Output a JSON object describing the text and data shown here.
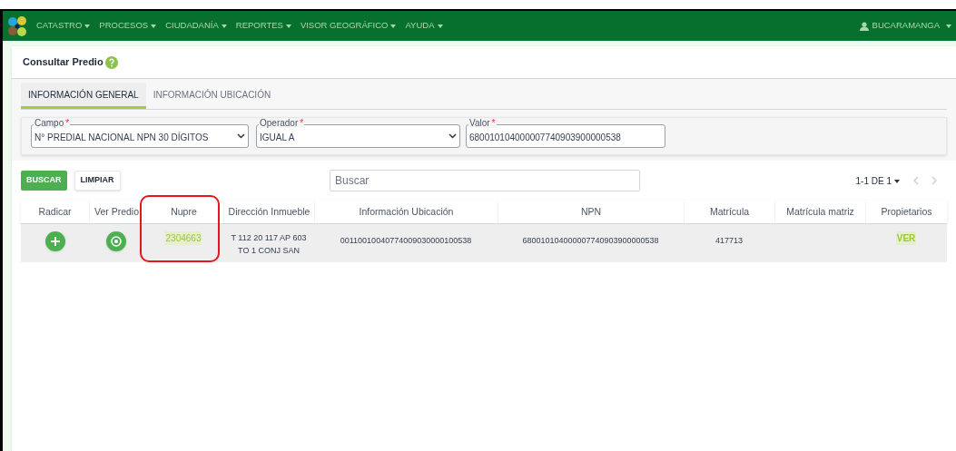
{
  "nav": {
    "menu": [
      {
        "label": "CATASTRO"
      },
      {
        "label": "PROCESOS"
      },
      {
        "label": "CIUDADANÍA"
      },
      {
        "label": "REPORTES"
      },
      {
        "label": "VISOR GEOGRÁFICO"
      },
      {
        "label": "AYUDA"
      }
    ],
    "user": "BUCARAMANGA"
  },
  "page_title": "Consultar Predio",
  "tabs": [
    {
      "label": "INFORMACIÓN GENERAL",
      "selected": true
    },
    {
      "label": "INFORMACIÓN UBICACIÓN",
      "selected": false
    }
  ],
  "filters": [
    {
      "kind": "select",
      "label": "Campo",
      "required_mark": "*",
      "value": "N° PREDIAL NACIONAL NPN 30 DÍGITOS"
    },
    {
      "kind": "select",
      "label": "Operador",
      "required_mark": "*",
      "value": "IGUAL A"
    },
    {
      "kind": "text",
      "label": "Valor",
      "required_mark": "*",
      "value": "680010104000007740903900000538"
    }
  ],
  "buttons": [
    {
      "label": "BUSCAR",
      "kind": "primary"
    },
    {
      "label": "LIMPIAR",
      "kind": "secondary"
    }
  ],
  "search": {
    "placeholder": "Buscar"
  },
  "pagination": {
    "label": "1-1 DE 1"
  },
  "table": {
    "columns": [
      "Radicar",
      "Ver Predio",
      "Nupre",
      "Dirección Inmueble",
      "Información Ubicación",
      "NPN",
      "Matrícula",
      "Matrícula matriz",
      "Propietarios"
    ],
    "rows": [
      {
        "nupre": "2304663",
        "direccion": "T 112 20 117 AP 603 TO 1 CONJ SAN",
        "informacion_ubicacion": "00110010040774009030000100538",
        "npn": "680010104000007740903900000538",
        "matricula": "417713",
        "propietarios": "VER"
      }
    ]
  }
}
